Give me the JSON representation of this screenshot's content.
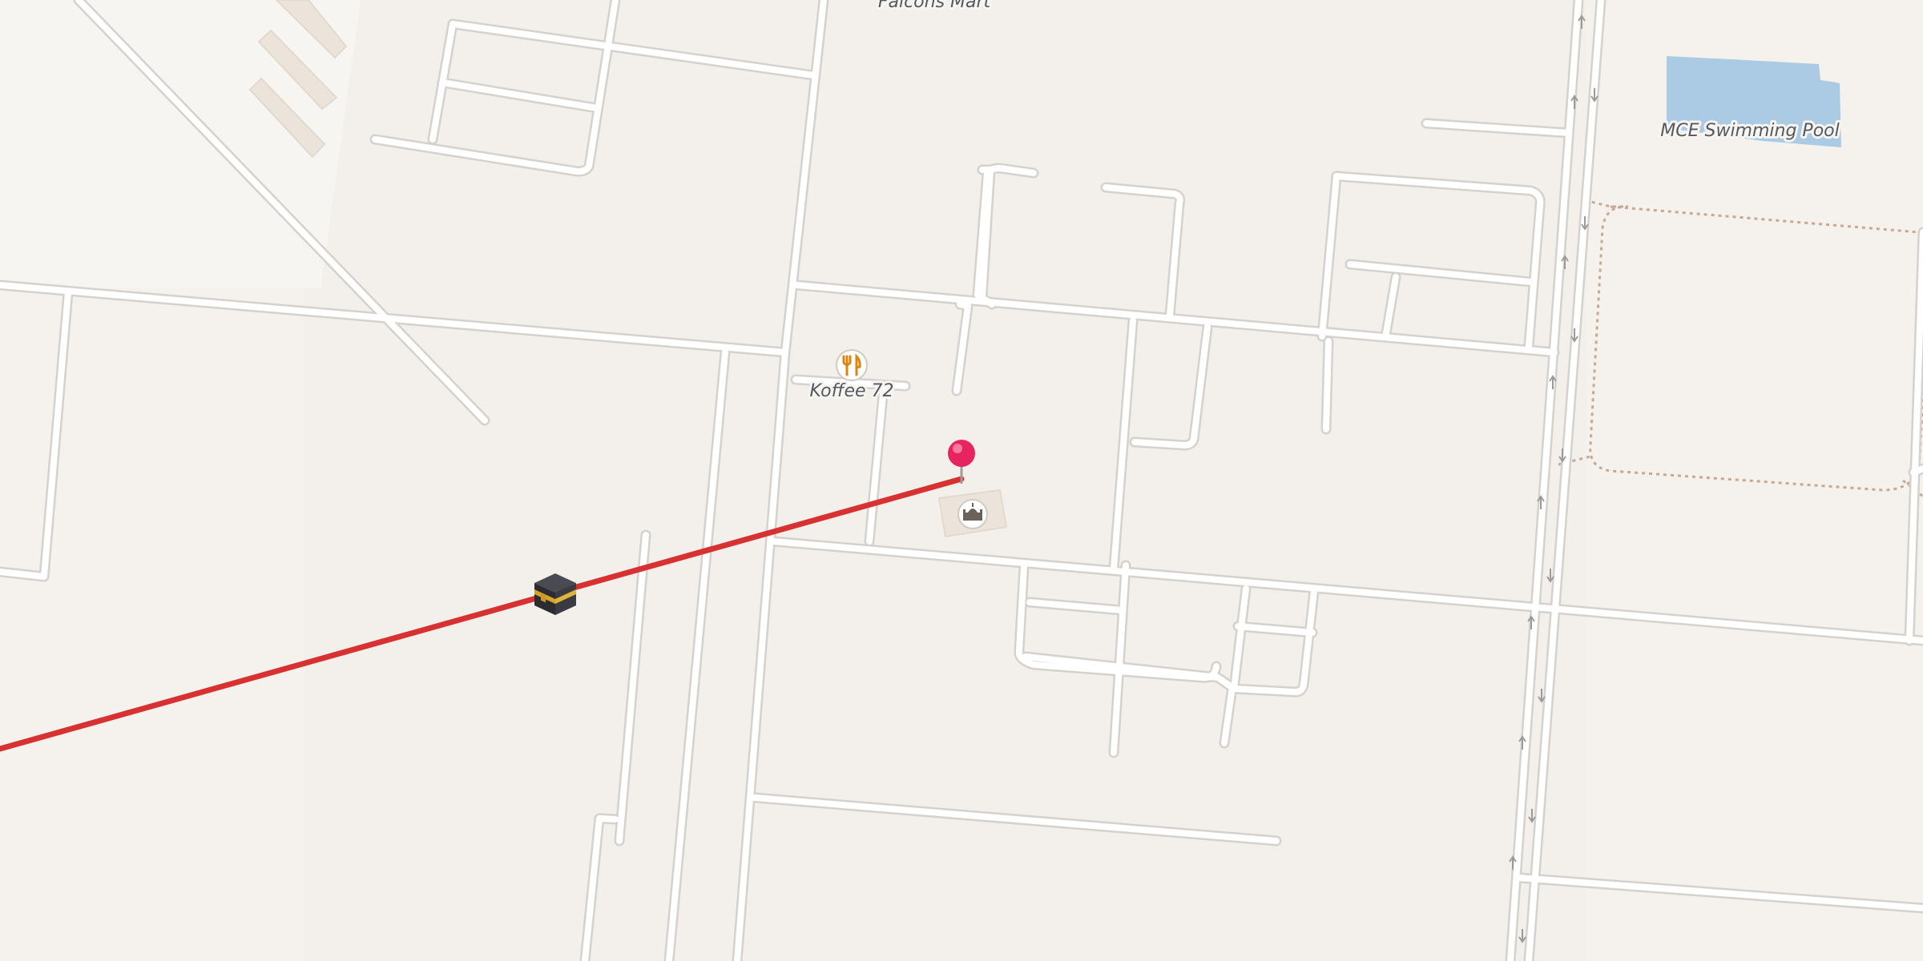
{
  "map": {
    "labels": {
      "falcons_mart": "Falcons Mart",
      "koffee_72": "Koffee 72",
      "pool": "MCE Swimming Pool"
    },
    "markers": {
      "dropped_pin": {
        "icon": "map-pin-icon",
        "color": "#e8245f"
      },
      "kaaba": {
        "icon": "kaaba-icon"
      },
      "restaurant": {
        "icon": "fork-knife-icon",
        "color": "#d9870f"
      },
      "place_of_worship": {
        "icon": "mosque-icon",
        "color": "#6d625a"
      }
    },
    "qibla_line": {
      "color": "#d83131"
    },
    "colors": {
      "background": "#f4f1ec",
      "road_fill": "#ffffff",
      "road_casing": "#d5d2cd",
      "water": "#aacbe3",
      "building": "#ede6de",
      "footpath": "#c7a992"
    }
  }
}
